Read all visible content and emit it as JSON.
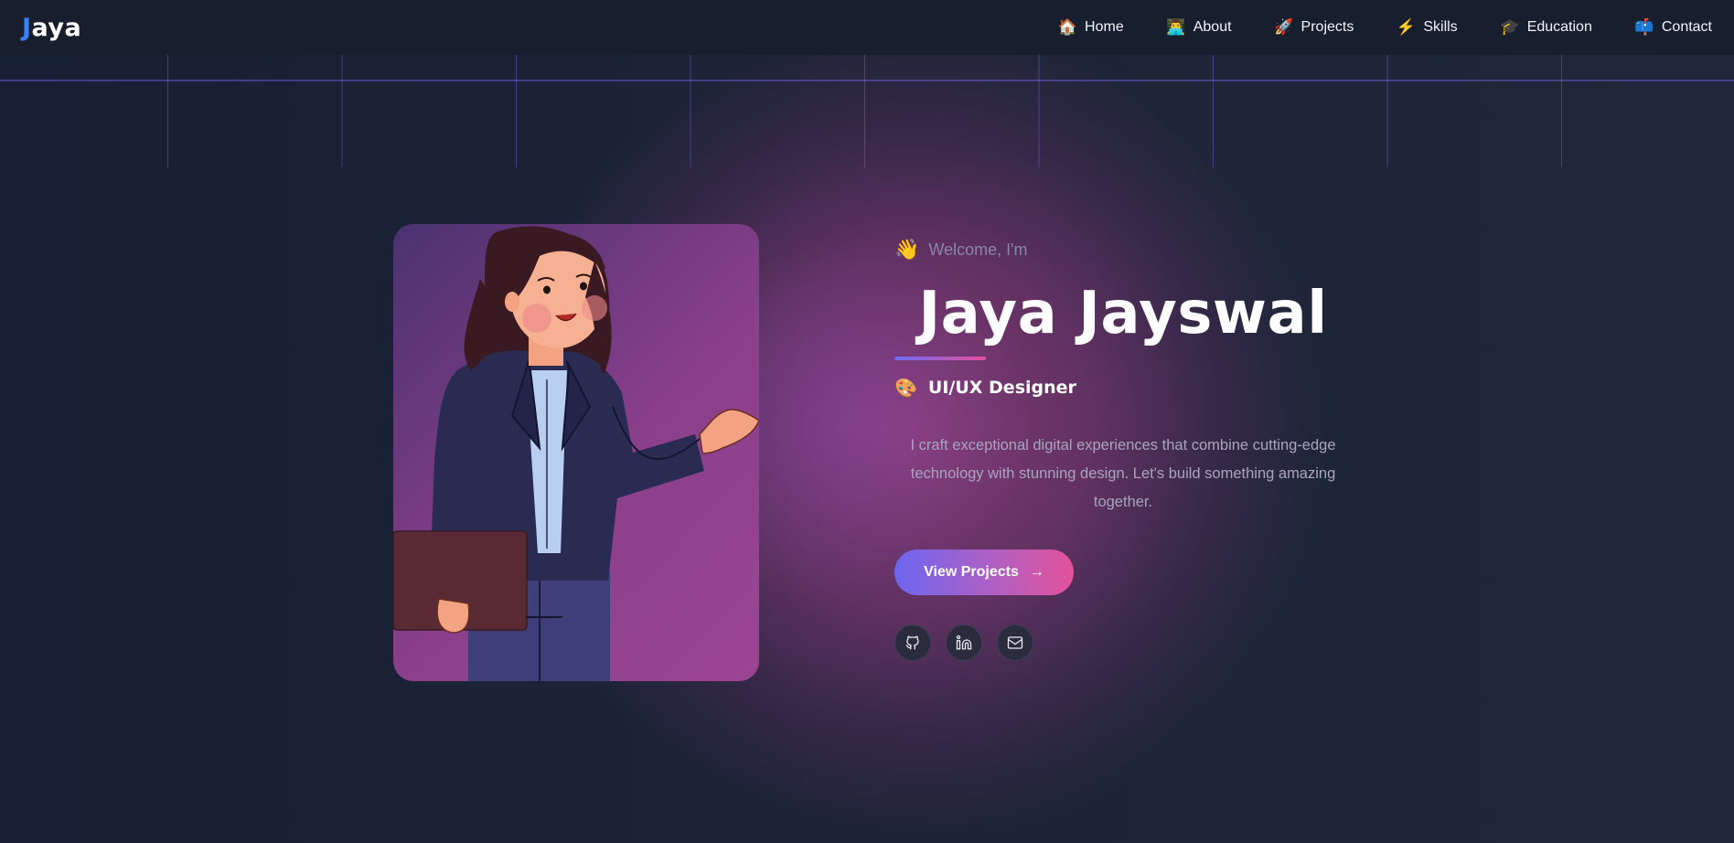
{
  "brand": {
    "logo_first": "J",
    "logo_rest": "aya"
  },
  "nav": [
    {
      "icon": "🏠",
      "icon_name": "home-icon",
      "label": "Home"
    },
    {
      "icon": "👨‍💻",
      "icon_name": "technologist-icon",
      "label": "About"
    },
    {
      "icon": "🚀",
      "icon_name": "rocket-icon",
      "label": "Projects"
    },
    {
      "icon": "⚡",
      "icon_name": "lightning-icon",
      "label": "Skills"
    },
    {
      "icon": "🎓",
      "icon_name": "graduation-cap-icon",
      "label": "Education"
    },
    {
      "icon": "📫",
      "icon_name": "mailbox-icon",
      "label": "Contact"
    }
  ],
  "hero": {
    "welcome_icon": "👋",
    "welcome": "Welcome, I'm",
    "name": "Jaya Jayswal",
    "role_icon": "🎨",
    "role": "UI/UX Designer",
    "description": "I craft exceptional digital experiences that combine cutting-edge technology with stunning design. Let's build something amazing together.",
    "cta": "View Projects",
    "cta_icon": "→"
  },
  "socials": [
    {
      "icon_name": "github-icon"
    },
    {
      "icon_name": "linkedin-icon"
    },
    {
      "icon_name": "mail-icon"
    }
  ],
  "colors": {
    "accent_blue": "#3b82f6",
    "gradient_start": "#6d66f0",
    "gradient_end": "#e5519a",
    "nav_bg": "#171e2d",
    "page_bg": "#1b2233"
  }
}
